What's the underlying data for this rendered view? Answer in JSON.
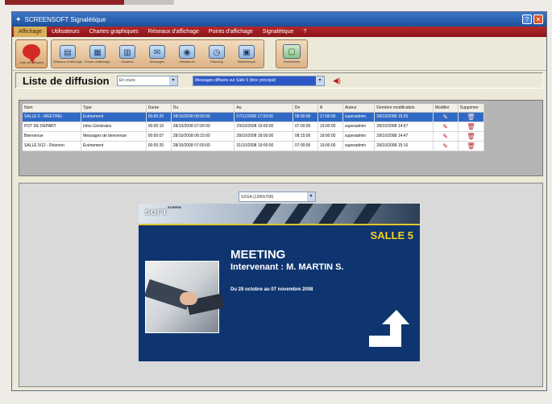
{
  "window": {
    "title": "SCREENSOFT Signalétique"
  },
  "menu": [
    "Affichage",
    "Utilisateurs",
    "Chartes graphiques",
    "Réseaux d'affichage",
    "Points d'affichage",
    "Signalétique",
    "?"
  ],
  "toolbar": {
    "first": {
      "caption": "Liste de diffusion",
      "icon": "speech-bubble-icon"
    },
    "buttons": [
      {
        "caption": "Réseaux d'affichage",
        "icon": "network-icon",
        "glyph": "▤"
      },
      {
        "caption": "Points d'affichage",
        "icon": "screen-icon",
        "glyph": "▦"
      },
      {
        "caption": "Modèles",
        "icon": "template-icon",
        "glyph": "▥"
      },
      {
        "caption": "Messages",
        "icon": "chat-icon",
        "glyph": "✉"
      },
      {
        "caption": "Utilisateurs",
        "icon": "users-icon",
        "glyph": "◉"
      },
      {
        "caption": "Planning",
        "icon": "clock-icon",
        "glyph": "◷"
      },
      {
        "caption": "Bibliothèque",
        "icon": "library-icon",
        "glyph": "▣"
      }
    ],
    "last": {
      "caption": "Paramètres",
      "icon": "settings-screen-icon",
      "glyph": "▢"
    }
  },
  "filter": {
    "title": "Liste de diffusion",
    "select1": "En cours",
    "select2": "Messages diffusés sur Salle 5 (bloc principal)"
  },
  "table": {
    "columns": [
      "Nom",
      "Type",
      "Durée",
      "Du",
      "Au",
      "De",
      "À",
      "Auteur",
      "Dernière modification",
      "Modifier",
      "Supprimer"
    ],
    "rows": [
      [
        "SALLE 5 - MEETING",
        "Evénement",
        "00:00:20",
        "28/10/2008 08:00:00",
        "07/11/2008 17:00:00",
        "08:00:00",
        "17:00:00",
        "superadmin",
        "28/10/2008 15:25"
      ],
      [
        "POT DE DEPART",
        "Infos Générales",
        "00:00:10",
        "28/10/2008 07:00:00",
        "29/10/2008 19:00:00",
        "07:00:00",
        "19:00:00",
        "superadmin",
        "28/10/2008 14:57"
      ],
      [
        "Bienvenue",
        "Messages de bienvenue",
        "00:00:07",
        "28/10/2008 08:15:00",
        "28/10/2008 18:00:00",
        "08:15:00",
        "18:00:00",
        "superadmin",
        "28/10/2008 14:47"
      ],
      [
        "SALLE 5/12 - Réunion",
        "Evénement",
        "00:00:20",
        "28/10/2008 07:00:00",
        "31/10/2008 19:00:00",
        "07:00:00",
        "19:00:00",
        "superadmin",
        "28/10/2008 15:16"
      ]
    ]
  },
  "preview": {
    "resolution": "SXGA (1280x768)",
    "logo": "SCREENSOFT",
    "logo_small": "SCREEN",
    "logo_big": "SOFT",
    "room": "SALLE 5",
    "title": "MEETING",
    "speaker": "Intervenant : M. MARTIN S.",
    "dates": "Du 28 octobre au 07 novembre 2008"
  },
  "colors": {
    "menubar": "#a11c1f",
    "selection": "#316ac5",
    "preview_bg": "#0f3570",
    "room_text": "#f5d21d"
  }
}
